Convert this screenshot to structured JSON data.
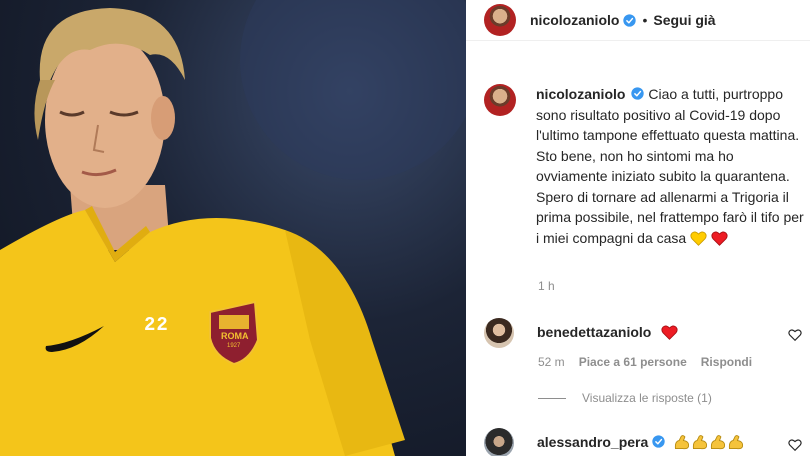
{
  "post": {
    "username": "nicolozaniolo",
    "follow_label": "Segui già",
    "separator": "•",
    "caption": "Ciao a tutti, purtroppo sono risultato positivo al Covid-19 dopo l'ultimo tampone effettuato questa mattina. Sto bene, non ho sintomi ma ho ovviamente iniziato subito la quarantena. Spero di tornare ad allenarmi a Trigoria il prima possibile, nel frattempo farò il tifo per i miei compagni da casa",
    "caption_emojis": [
      "yellow-heart",
      "red-heart"
    ],
    "time": "1 h",
    "jersey_number": "22",
    "crest_text": "ROMA",
    "crest_year": "1927"
  },
  "comments": [
    {
      "username": "benedettazaniolo",
      "emojis": [
        "red-heart"
      ],
      "time": "52 m",
      "likes": "Piace a 61 persone",
      "reply_label": "Rispondi",
      "view_replies": "Visualizza le risposte (1)"
    },
    {
      "username": "alessandro_pera",
      "emojis": [
        "flexed-biceps",
        "flexed-biceps",
        "flexed-biceps",
        "flexed-biceps"
      ]
    }
  ],
  "colors": {
    "verified": "#3897f0",
    "heart": "#ed1c24",
    "yellow_heart": "#ffcc00",
    "muted": "#8e8e8e",
    "jersey": "#f4c51a"
  }
}
